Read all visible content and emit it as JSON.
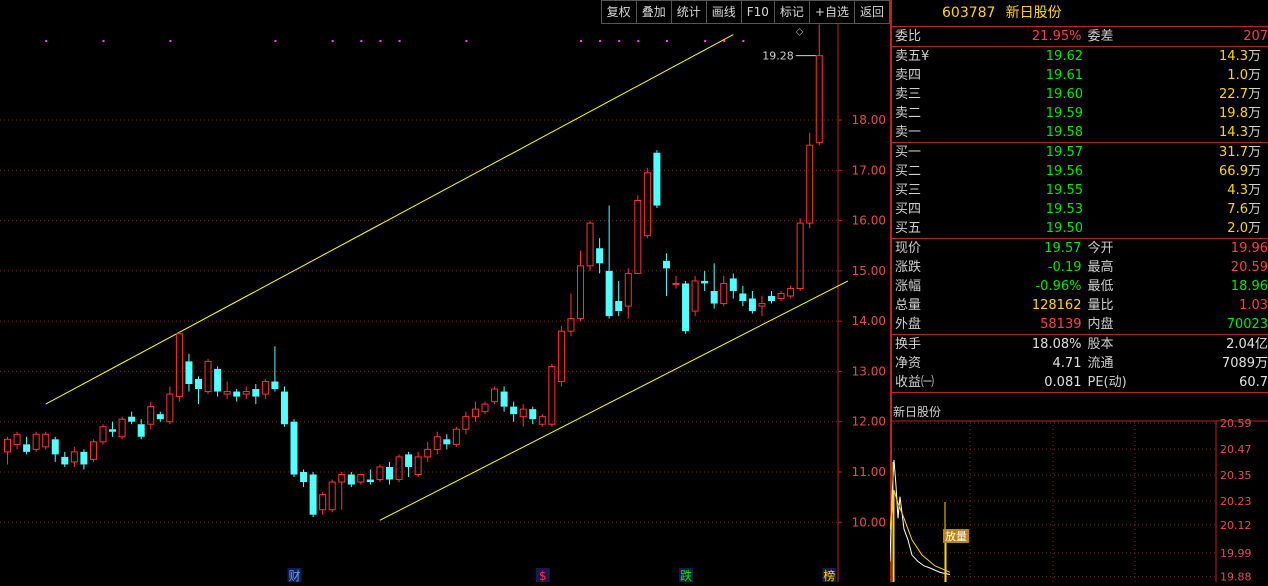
{
  "toolbar": [
    "复权",
    "叠加",
    "统计",
    "画线",
    "F10",
    "标记",
    "+自选",
    "返回"
  ],
  "stock": {
    "code": "603787",
    "name": "新日股份"
  },
  "order": {
    "webi_label": "委比",
    "webi": "21.95%",
    "weicha_label": "委差",
    "weicha": "207",
    "sell": [
      {
        "label": "卖五",
        "mark": "¥",
        "price": "19.62",
        "vol": "14.3",
        "unit": "万"
      },
      {
        "label": "卖四",
        "mark": "",
        "price": "19.61",
        "vol": "1.0",
        "unit": "万"
      },
      {
        "label": "卖三",
        "mark": "",
        "price": "19.60",
        "vol": "22.7",
        "unit": "万"
      },
      {
        "label": "卖二",
        "mark": "",
        "price": "19.59",
        "vol": "19.8",
        "unit": "万"
      },
      {
        "label": "卖一",
        "mark": "",
        "price": "19.58",
        "vol": "14.3",
        "unit": "万"
      }
    ],
    "buy": [
      {
        "label": "买一",
        "price": "19.57",
        "vol": "31.7",
        "unit": "万"
      },
      {
        "label": "买二",
        "price": "19.56",
        "vol": "66.9",
        "unit": "万"
      },
      {
        "label": "买三",
        "price": "19.55",
        "vol": "4.3",
        "unit": "万"
      },
      {
        "label": "买四",
        "price": "19.53",
        "vol": "7.6",
        "unit": "万"
      },
      {
        "label": "买五",
        "price": "19.50",
        "vol": "2.0",
        "unit": "万"
      }
    ]
  },
  "quote": [
    {
      "l1": "现价",
      "v1": "19.57",
      "c1": "g",
      "l2": "今开",
      "v2": "19.96",
      "c2": "r"
    },
    {
      "l1": "涨跌",
      "v1": "-0.19",
      "c1": "g",
      "l2": "最高",
      "v2": "20.59",
      "c2": "r"
    },
    {
      "l1": "涨幅",
      "v1": "-0.96%",
      "c1": "g",
      "l2": "最低",
      "v2": "18.96",
      "c2": "g"
    },
    {
      "l1": "总量",
      "v1": "128162",
      "c1": "y",
      "l2": "量比",
      "v2": "1.03",
      "c2": "r"
    },
    {
      "l1": "外盘",
      "v1": "58139",
      "c1": "r",
      "l2": "内盘",
      "v2": "70023",
      "c2": "g"
    }
  ],
  "finance": [
    {
      "l1": "换手",
      "v1": "18.08%",
      "l2": "股本",
      "v2": "2.04亿"
    },
    {
      "l1": "净资",
      "v1": "4.71",
      "l2": "流通",
      "v2": "7089万"
    },
    {
      "l1": "收益㈠",
      "v1": "0.081",
      "l2": "PE(动)",
      "v2": "60.7"
    }
  ],
  "chart_data": {
    "type": "candlestick",
    "y_ticks": [
      "18.00",
      "17.00",
      "16.00",
      "15.00",
      "14.00",
      "13.00",
      "12.00",
      "11.00",
      "10.00"
    ],
    "ylim": [
      9.15,
      19.95
    ],
    "last_label": "19.28",
    "up_color": "#ff3232",
    "down_color": "#54ffff",
    "trend_line_color": "#ffff00",
    "markers": [
      {
        "text": "财",
        "color": "#54a8ff"
      },
      {
        "text": "$",
        "color": "#ff3232"
      },
      {
        "text": "跌",
        "color": "#00e600"
      },
      {
        "text": "榜",
        "color": "#ffd700"
      }
    ],
    "candles": [
      [
        11.4,
        11.65,
        11.7,
        11.15
      ],
      [
        11.55,
        11.75,
        11.8,
        11.45
      ],
      [
        11.55,
        11.4,
        11.7,
        11.35
      ],
      [
        11.45,
        11.75,
        11.8,
        11.4
      ],
      [
        11.5,
        11.75,
        11.8,
        11.45
      ],
      [
        11.65,
        11.35,
        11.7,
        11.2
      ],
      [
        11.3,
        11.15,
        11.4,
        11.1
      ],
      [
        11.2,
        11.4,
        11.5,
        11.1
      ],
      [
        11.4,
        11.15,
        11.45,
        11.05
      ],
      [
        11.25,
        11.6,
        11.65,
        11.2
      ],
      [
        11.6,
        11.9,
        11.95,
        11.55
      ],
      [
        11.85,
        11.8,
        12.0,
        11.7
      ],
      [
        11.7,
        12.05,
        12.1,
        11.65
      ],
      [
        12.1,
        12.0,
        12.2,
        11.95
      ],
      [
        11.95,
        11.7,
        12.05,
        11.65
      ],
      [
        11.95,
        12.3,
        12.4,
        11.85
      ],
      [
        12.15,
        12.05,
        12.2,
        12.0
      ],
      [
        12.0,
        12.55,
        12.7,
        11.95
      ],
      [
        12.5,
        13.75,
        13.8,
        12.4
      ],
      [
        13.2,
        12.75,
        13.35,
        12.6
      ],
      [
        12.85,
        12.65,
        12.9,
        12.35
      ],
      [
        12.6,
        13.2,
        13.25,
        12.55
      ],
      [
        13.05,
        12.6,
        13.1,
        12.5
      ],
      [
        12.55,
        12.6,
        12.8,
        12.45
      ],
      [
        12.6,
        12.5,
        12.65,
        12.4
      ],
      [
        12.55,
        12.6,
        12.7,
        12.45
      ],
      [
        12.65,
        12.5,
        12.75,
        12.35
      ],
      [
        12.55,
        12.8,
        12.85,
        12.45
      ],
      [
        12.8,
        12.65,
        13.5,
        12.6
      ],
      [
        12.6,
        11.95,
        12.7,
        11.9
      ],
      [
        12.0,
        10.95,
        12.05,
        10.9
      ],
      [
        11.0,
        10.8,
        11.05,
        10.7
      ],
      [
        10.95,
        10.15,
        11.0,
        10.1
      ],
      [
        10.25,
        10.55,
        10.6,
        10.15
      ],
      [
        10.25,
        10.8,
        10.85,
        10.2
      ],
      [
        10.8,
        10.95,
        11.0,
        10.25
      ],
      [
        10.95,
        10.75,
        11.0,
        10.7
      ],
      [
        10.8,
        10.95,
        10.95,
        10.75
      ],
      [
        10.85,
        10.8,
        11.05,
        10.75
      ],
      [
        10.85,
        11.1,
        11.15,
        10.8
      ],
      [
        11.1,
        10.85,
        11.2,
        10.75
      ],
      [
        10.85,
        11.3,
        11.35,
        10.8
      ],
      [
        11.35,
        11.1,
        11.4,
        10.9
      ],
      [
        10.95,
        11.3,
        11.4,
        10.9
      ],
      [
        11.3,
        11.45,
        11.6,
        11.2
      ],
      [
        11.45,
        11.7,
        11.8,
        11.35
      ],
      [
        11.65,
        11.55,
        11.75,
        11.45
      ],
      [
        11.55,
        11.85,
        11.9,
        11.5
      ],
      [
        11.85,
        12.1,
        12.2,
        11.75
      ],
      [
        12.1,
        12.25,
        12.4,
        12.0
      ],
      [
        12.2,
        12.35,
        12.4,
        12.15
      ],
      [
        12.4,
        12.65,
        12.7,
        12.35
      ],
      [
        12.6,
        12.3,
        12.7,
        12.2
      ],
      [
        12.3,
        12.15,
        12.4,
        12.0
      ],
      [
        12.1,
        12.25,
        12.35,
        11.9
      ],
      [
        12.25,
        12.05,
        12.3,
        11.95
      ],
      [
        11.95,
        12.1,
        12.15,
        11.9
      ],
      [
        11.95,
        13.1,
        13.15,
        11.9
      ],
      [
        12.8,
        13.8,
        13.9,
        12.7
      ],
      [
        13.8,
        14.05,
        14.55,
        13.7
      ],
      [
        14.05,
        15.1,
        15.4,
        14.0
      ],
      [
        15.1,
        15.95,
        16.0,
        15.0
      ],
      [
        15.45,
        15.15,
        15.65,
        14.95
      ],
      [
        15.0,
        14.1,
        16.3,
        14.05
      ],
      [
        14.4,
        14.2,
        14.8,
        14.1
      ],
      [
        14.3,
        14.95,
        15.05,
        14.05
      ],
      [
        14.95,
        16.4,
        16.5,
        14.95
      ],
      [
        15.7,
        16.95,
        17.05,
        15.65
      ],
      [
        17.35,
        16.3,
        17.4,
        16.25
      ],
      [
        15.2,
        15.05,
        15.35,
        14.5
      ],
      [
        14.75,
        14.75,
        14.9,
        14.65
      ],
      [
        14.75,
        13.8,
        14.8,
        13.75
      ],
      [
        14.2,
        14.8,
        14.9,
        14.1
      ],
      [
        14.8,
        14.75,
        15.0,
        14.6
      ],
      [
        14.6,
        14.35,
        15.15,
        14.25
      ],
      [
        14.35,
        14.75,
        14.9,
        14.3
      ],
      [
        14.85,
        14.6,
        14.95,
        14.45
      ],
      [
        14.55,
        14.4,
        14.7,
        14.3
      ],
      [
        14.45,
        14.2,
        14.6,
        14.15
      ],
      [
        14.3,
        14.35,
        14.5,
        14.1
      ],
      [
        14.5,
        14.4,
        14.6,
        14.35
      ],
      [
        14.45,
        14.55,
        14.6,
        14.4
      ],
      [
        14.5,
        14.65,
        14.7,
        14.45
      ],
      [
        14.65,
        15.95,
        16.05,
        14.6
      ],
      [
        15.95,
        17.5,
        17.75,
        15.85
      ],
      [
        17.55,
        19.28,
        19.9,
        17.5
      ]
    ],
    "intraday_ticks": [
      "20.59",
      "20.47",
      "20.35",
      "20.23",
      "20.12",
      "19.99",
      "19.88"
    ],
    "intraday_ylim": [
      19.86,
      20.6
    ]
  },
  "mini_title": "新日股份",
  "mini_badge": "放量"
}
